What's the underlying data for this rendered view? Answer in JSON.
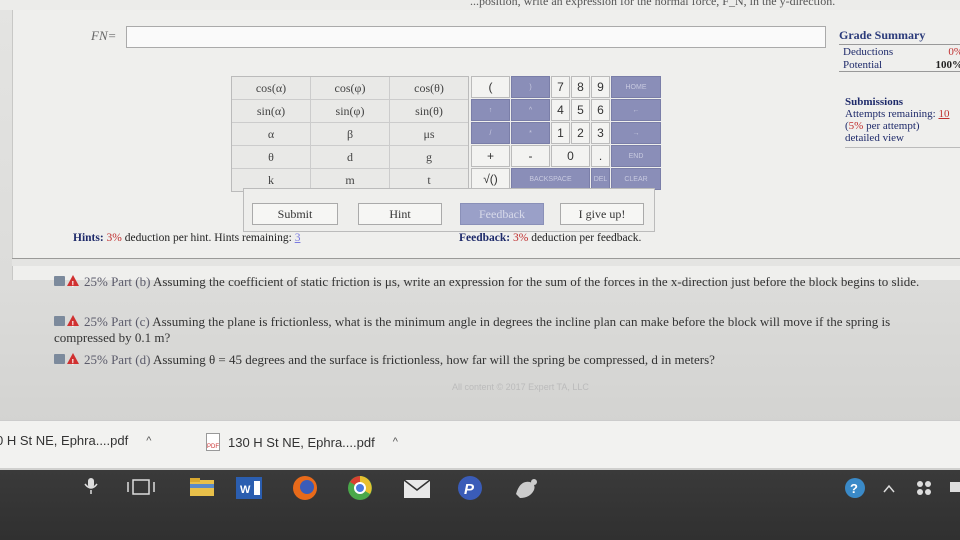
{
  "top_strip_text": "...position, write an expression for the normal force, F_N, in the y-direction.",
  "answer": {
    "label": "FN=",
    "value": ""
  },
  "grade_summary": {
    "title": "Grade Summary",
    "deductions_label": "Deductions",
    "deductions_value": "0%",
    "potential_label": "Potential",
    "potential_value": "100%"
  },
  "submissions": {
    "title": "Submissions",
    "attempts_label": "Attempts remaining:",
    "attempts_value": "10",
    "per_attempt_prefix": "(",
    "per_attempt_pct": "5%",
    "per_attempt_suffix": " per attempt)",
    "detailed_view": "detailed view"
  },
  "function_keys": [
    "cos(α)",
    "cos(φ)",
    "cos(θ)",
    "sin(α)",
    "sin(φ)",
    "sin(θ)",
    "α",
    "β",
    "μs",
    "θ",
    "d",
    "g",
    "k",
    "m",
    "t"
  ],
  "numeric_keys": {
    "row1": [
      "(",
      ")",
      "7",
      "8",
      "9",
      "HOME"
    ],
    "row2": [
      "↑",
      "^",
      "4",
      "5",
      "6",
      "←"
    ],
    "row3": [
      "/",
      "*",
      "1",
      "2",
      "3",
      "→"
    ],
    "row4": [
      "+",
      "-",
      "0",
      ".",
      "END"
    ],
    "row5": [
      "√()",
      "BACKSPACE",
      "DEL",
      "CLEAR"
    ]
  },
  "buttons": {
    "submit": "Submit",
    "hint": "Hint",
    "feedback": "Feedback",
    "give_up": "I give up!"
  },
  "hints": {
    "label": "Hints:",
    "pct": "3%",
    "text": " deduction per hint. Hints remaining: ",
    "remaining": "3"
  },
  "feedback_note": {
    "label": "Feedback:",
    "pct": "3%",
    "text": " deduction per feedback."
  },
  "parts": [
    {
      "label": "25% Part (b)",
      "text": " Assuming the coefficient of static friction is μs, write an expression for the sum of the forces in the x-direction just before the block begins to slide."
    },
    {
      "label": "25% Part (c)",
      "text": " Assuming the plane is frictionless, what is the minimum angle in degrees the incline plan can make before the block will move if the spring is compressed by 0.1 m?"
    },
    {
      "label": "25% Part (d)",
      "text": " Assuming θ = 45 degrees and the surface is frictionless, how far will the spring be compressed, d in meters?"
    }
  ],
  "copyright": "All content © 2017 Expert TA, LLC",
  "downloads": [
    {
      "name": "0 H St NE, Ephra....pdf"
    },
    {
      "name": "130 H St NE, Ephra....pdf"
    }
  ],
  "colors": {
    "accent_blue": "#1e2a6a",
    "deduction_red": "#c03030",
    "keypad_dark": "#8a8eb8"
  }
}
